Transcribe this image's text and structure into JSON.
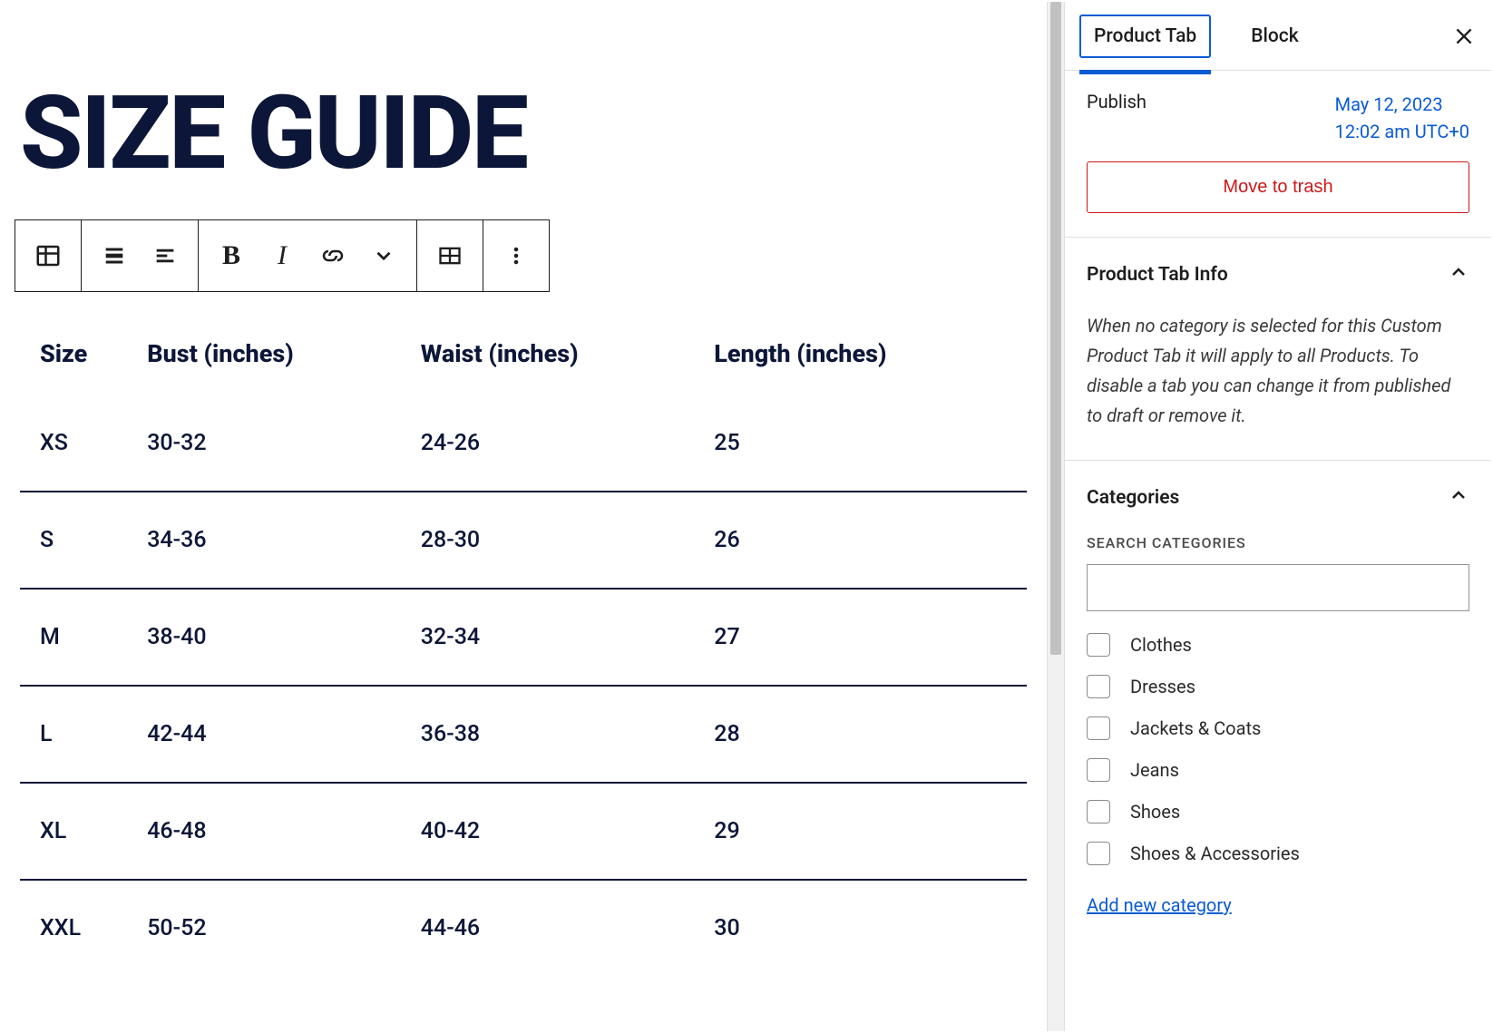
{
  "editor": {
    "title": "SIZE GUIDE",
    "table": {
      "headers": [
        "Size",
        "Bust (inches)",
        "Waist (inches)",
        "Length (inches)"
      ],
      "rows": [
        [
          "XS",
          "30-32",
          "24-26",
          "25"
        ],
        [
          "S",
          "34-36",
          "28-30",
          "26"
        ],
        [
          "M",
          "38-40",
          "32-34",
          "27"
        ],
        [
          "L",
          "42-44",
          "36-38",
          "28"
        ],
        [
          "XL",
          "46-48",
          "40-42",
          "29"
        ],
        [
          "XXL",
          "50-52",
          "44-46",
          "30"
        ]
      ]
    }
  },
  "toolbar": {
    "block_type": "table-block",
    "bold": "B",
    "italic": "I"
  },
  "sidebar": {
    "tabs": {
      "product_tab": "Product Tab",
      "block": "Block"
    },
    "publish": {
      "label": "Publish",
      "date": "May 12, 2023",
      "time": "12:02 am UTC+0"
    },
    "trash_btn": "Move to trash",
    "info": {
      "title": "Product Tab Info",
      "text": "When no category is selected for this Custom Product Tab it will apply to all Products. To disable a tab you can change it from published to draft or remove it."
    },
    "categories": {
      "title": "Categories",
      "search_label": "SEARCH CATEGORIES",
      "items": [
        "Clothes",
        "Dresses",
        "Jackets & Coats",
        "Jeans",
        "Shoes",
        "Shoes & Accessories"
      ],
      "add_new": "Add new category"
    }
  }
}
